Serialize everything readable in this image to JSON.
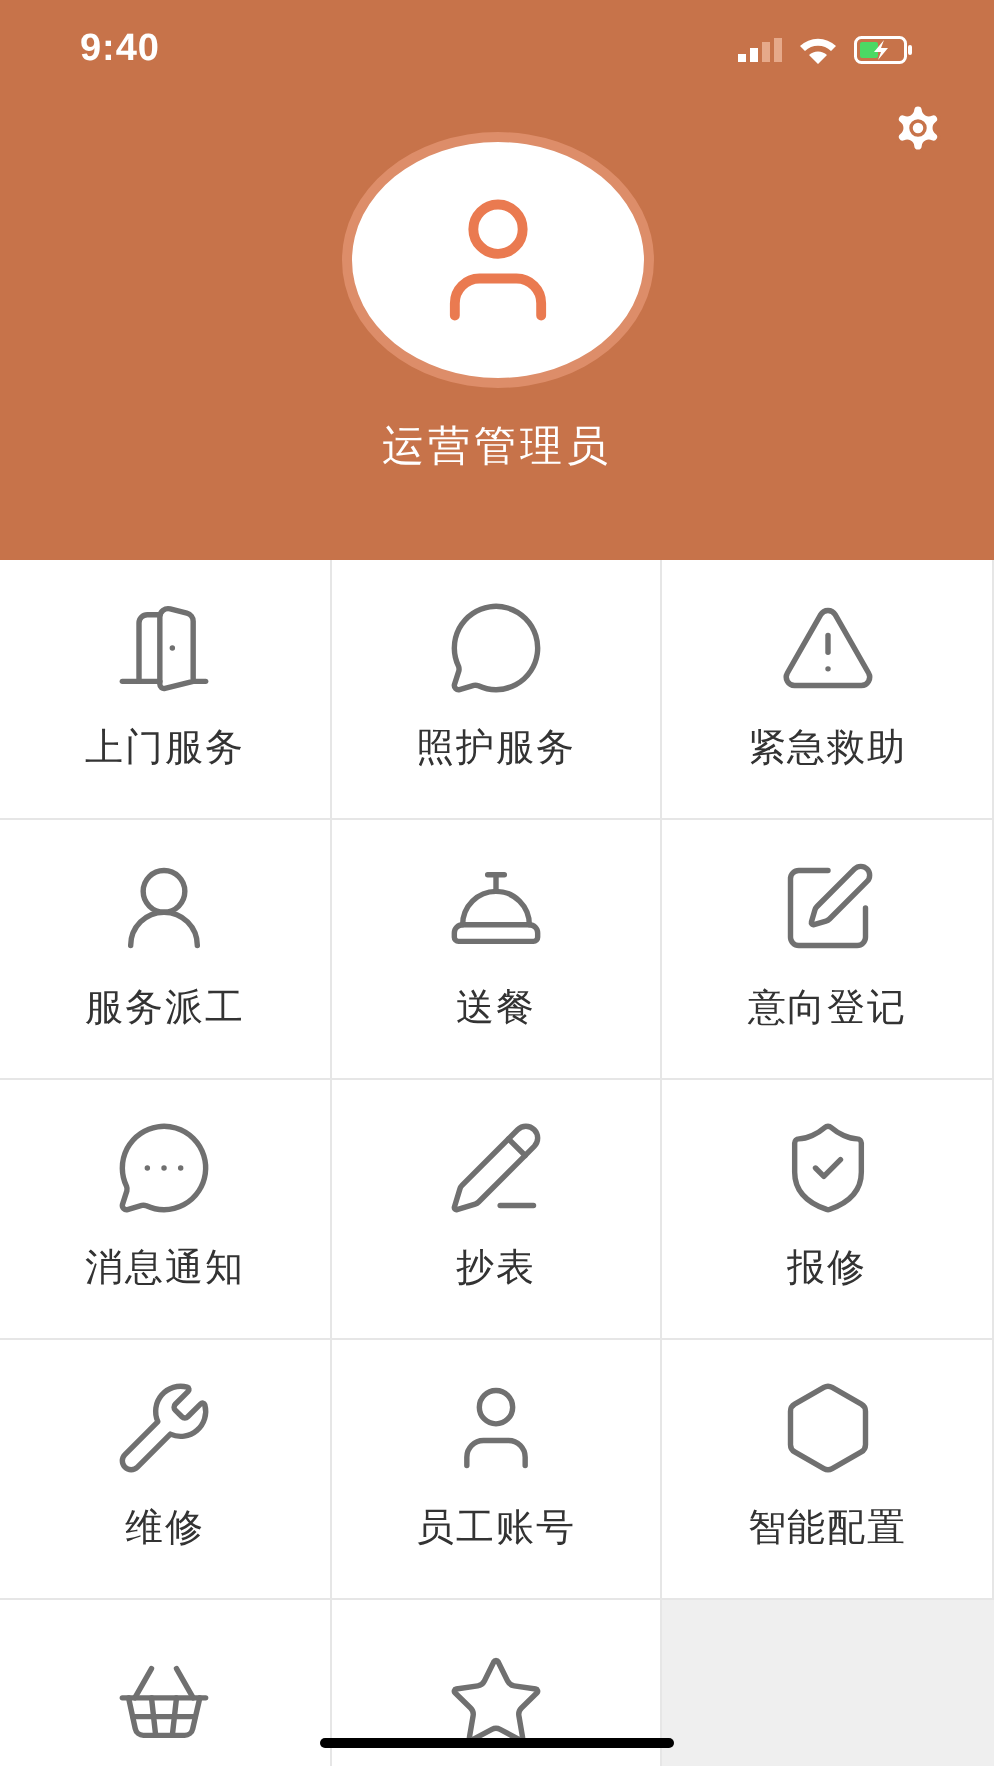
{
  "status_bar": {
    "time": "9:40"
  },
  "profile": {
    "name": "运营管理员"
  },
  "grid": {
    "items": [
      {
        "kind": "tile",
        "label": "上门服务"
      },
      {
        "kind": "tile",
        "label": "照护服务"
      },
      {
        "kind": "tile",
        "label": "紧急救助"
      },
      {
        "kind": "tile",
        "label": "服务派工"
      },
      {
        "kind": "tile",
        "label": "送餐"
      },
      {
        "kind": "tile",
        "label": "意向登记"
      },
      {
        "kind": "tile",
        "label": "消息通知"
      },
      {
        "kind": "tile",
        "label": "抄表"
      },
      {
        "kind": "tile",
        "label": "报修"
      },
      {
        "kind": "tile",
        "label": "维修"
      },
      {
        "kind": "tile",
        "label": "员工账号"
      },
      {
        "kind": "tile",
        "label": "智能配置"
      },
      {
        "kind": "partial"
      },
      {
        "kind": "partial"
      }
    ]
  }
}
